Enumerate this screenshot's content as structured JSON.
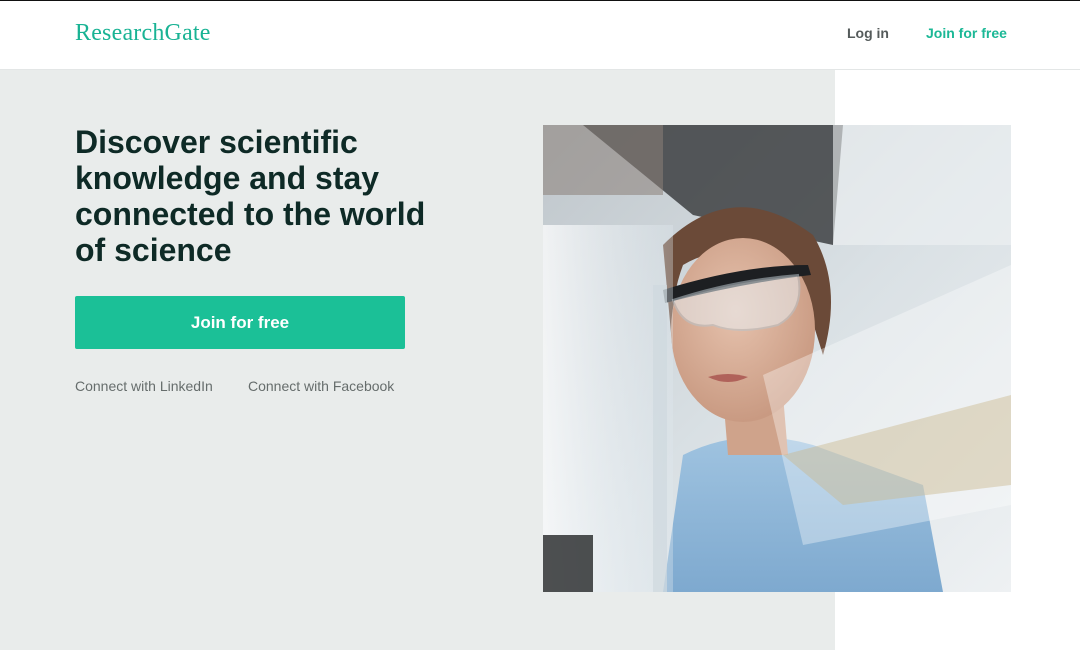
{
  "header": {
    "logo_text": "ResearchGate",
    "login_label": "Log in",
    "join_label": "Join for free"
  },
  "hero": {
    "headline_lines": [
      "Discover scientific",
      "knowledge and stay",
      "connected to the world",
      "of science"
    ],
    "cta_label": "Join for free",
    "connect_linkedin": "Connect with LinkedIn",
    "connect_facebook": "Connect with Facebook"
  },
  "colors": {
    "brand_green": "#1bc097",
    "hero_bg": "#e9eceb",
    "headline": "#0e2a26"
  }
}
